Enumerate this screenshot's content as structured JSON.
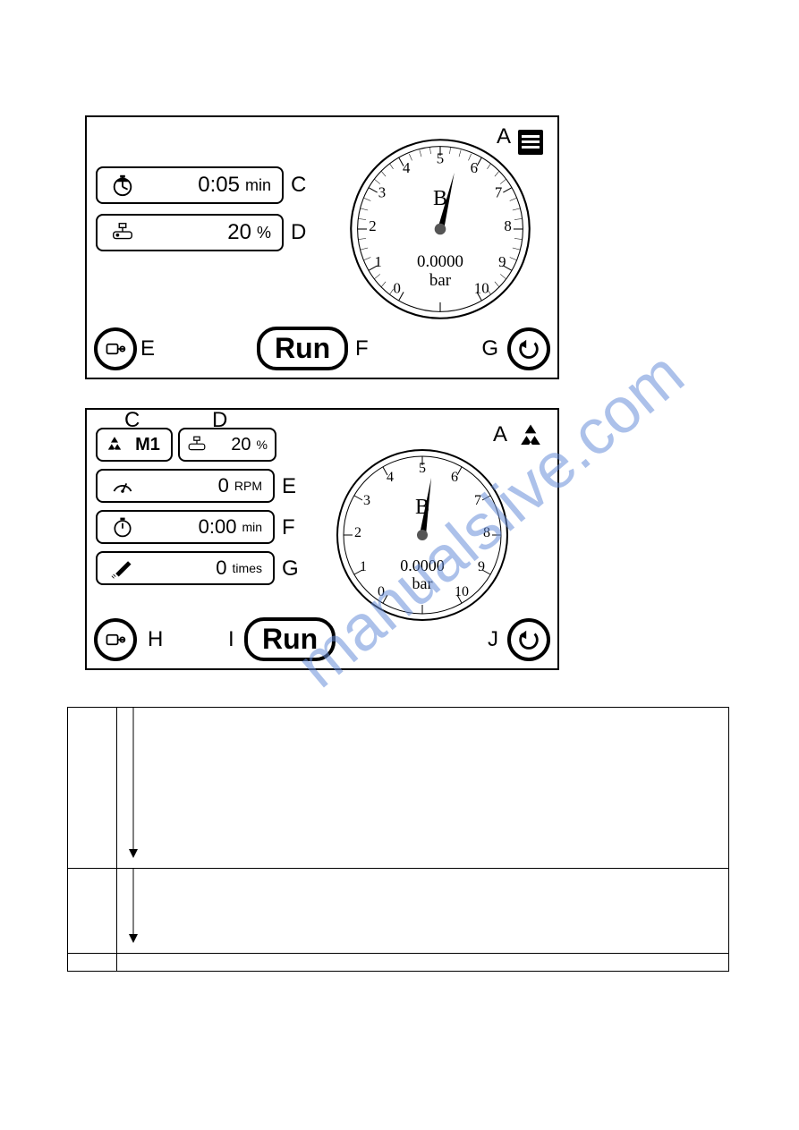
{
  "watermark": "manualslive.com",
  "panel1": {
    "cornerA": "A",
    "time": {
      "value": "0:05",
      "unit": "min",
      "callout": "C"
    },
    "percent": {
      "value": "20",
      "unit": "%",
      "callout": "D"
    },
    "gauge": {
      "callout": "B",
      "numbers": [
        "0",
        "1",
        "2",
        "3",
        "4",
        "5",
        "6",
        "7",
        "8",
        "9",
        "10"
      ],
      "reading": "0.0000",
      "unit": "bar"
    },
    "btnE": {
      "callout": "E"
    },
    "run": {
      "label": "Run",
      "callout": "F"
    },
    "back": {
      "callout": "G"
    }
  },
  "panel2": {
    "m1": {
      "value": "M1",
      "callout": "C"
    },
    "percent": {
      "value": "20",
      "unit": "%",
      "callout": "D"
    },
    "cornerA": "A",
    "rpm": {
      "value": "0",
      "unit": "RPM",
      "callout": "E"
    },
    "time": {
      "value": "0:00",
      "unit": "min",
      "callout": "F"
    },
    "times": {
      "value": "0",
      "unit": "times",
      "callout": "G"
    },
    "gauge": {
      "callout": "B",
      "numbers": [
        "0",
        "1",
        "2",
        "3",
        "4",
        "5",
        "6",
        "7",
        "8",
        "9",
        "10"
      ],
      "reading": "0.0000",
      "unit": "bar"
    },
    "btnH": {
      "callout": "H"
    },
    "run": {
      "label": "Run",
      "callout": "I"
    },
    "back": {
      "callout": "J"
    }
  }
}
